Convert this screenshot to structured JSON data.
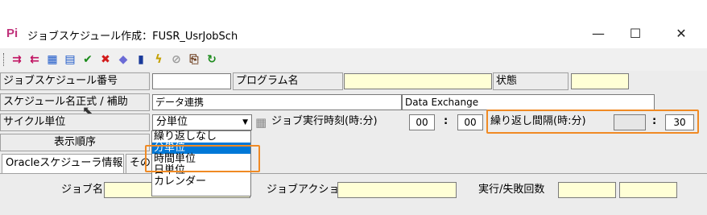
{
  "window": {
    "app_icon": "Pi",
    "title": "ジョブスケジュール作成：FUSR_UsrJobSch",
    "controls": {
      "minimize": "—",
      "maximize": "☐",
      "close": "✕"
    }
  },
  "toolbar": {
    "icons": [
      {
        "name": "import-icon",
        "glyph": "⇉",
        "color": "#c01060"
      },
      {
        "name": "export-icon",
        "glyph": "⇇",
        "color": "#c01060"
      },
      {
        "name": "print-preview-icon",
        "glyph": "▦",
        "color": "#1a57c9"
      },
      {
        "name": "print-icon",
        "glyph": "▤",
        "color": "#1a57c9"
      },
      {
        "name": "check-icon",
        "glyph": "✔",
        "color": "#1a8a1a"
      },
      {
        "name": "delete-icon",
        "glyph": "✖",
        "color": "#d21a1a"
      },
      {
        "name": "erase-icon",
        "glyph": "◆",
        "color": "#6b6bd6"
      },
      {
        "name": "chart-icon",
        "glyph": "▮",
        "color": "#1a3a9a"
      },
      {
        "name": "run-icon",
        "glyph": "ϟ",
        "color": "#c4a000"
      },
      {
        "name": "stop-icon",
        "glyph": "⊘",
        "color": "#9a9a9a"
      },
      {
        "name": "copy-icon",
        "glyph": "⎘",
        "color": "#6a3a1a"
      },
      {
        "name": "refresh-icon",
        "glyph": "↻",
        "color": "#1a8a1a"
      }
    ]
  },
  "form": {
    "schedule_no_label": "ジョブスケジュール番号",
    "schedule_no_value": "",
    "program_name_label": "プログラム名",
    "program_name_value": "",
    "status_label": "状態",
    "status_value": "",
    "schedule_name_label": "スケジュール名正式 / 補助",
    "schedule_name_value": "データ連携",
    "schedule_sub_value": "Data Exchange",
    "cycle_unit_label": "サイクル単位",
    "cycle_unit_value": "分単位",
    "exec_time_label": "ジョブ実行時刻(時:分)",
    "exec_hour": "00",
    "exec_min": "00",
    "time_sep": ":",
    "repeat_interval_label": "繰り返し間隔(時:分)",
    "repeat_hour": "",
    "repeat_min": "30",
    "display_order_label": "表示順序",
    "cycle_options": [
      "繰り返しなし",
      "分単位",
      "時間単位",
      "日単位",
      "カレンダー"
    ],
    "cycle_selected_index": 1,
    "tabs": [
      "Oracleスケジューラ情報",
      "その"
    ],
    "job_name_label": "ジョブ名",
    "job_name_value": "",
    "job_action_label": "ジョブアクション",
    "job_action_value": "",
    "exec_fail_label": "実行/失敗回数",
    "exec_count_value": "",
    "fail_count_value": ""
  },
  "colors": {
    "highlight_orange": "#f08a24",
    "field_yellow": "#ffffd6",
    "selection_blue": "#0078d7"
  }
}
